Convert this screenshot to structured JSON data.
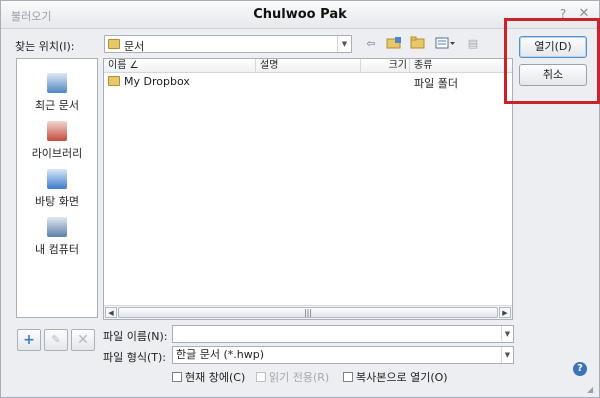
{
  "window": {
    "app_label": "불러오기",
    "title": "Chulwoo Pak",
    "help_glyph": "?",
    "close_glyph": "✕"
  },
  "location": {
    "label": "찾는 위치(I):",
    "value": "문서"
  },
  "toolbar": {
    "icons": [
      "back-icon",
      "folder-up-icon",
      "new-folder-icon",
      "view-menu-icon",
      "tools-icon"
    ]
  },
  "places": [
    {
      "label": "최근 문서",
      "icon": "recent-documents-icon",
      "color": "#4f86c6"
    },
    {
      "label": "라이브러리",
      "icon": "library-icon",
      "color": "#c44a3a"
    },
    {
      "label": "바탕 화면",
      "icon": "desktop-icon",
      "color": "#3e7cc9"
    },
    {
      "label": "내 컴퓨터",
      "icon": "computer-icon",
      "color": "#5a7fa8"
    }
  ],
  "file_list": {
    "columns": [
      "이름 ∠",
      "설명",
      "크기",
      "종류"
    ],
    "rows": [
      {
        "name": "My Dropbox",
        "type": "파일 폴더"
      }
    ]
  },
  "buttons": {
    "open": "열기(D)",
    "cancel": "취소"
  },
  "filename": {
    "label": "파일 이름(N):",
    "value": ""
  },
  "filetype": {
    "label": "파일 형식(T):",
    "value": "한글 문서 (*.hwp)"
  },
  "options": {
    "current_window": "현재 창에(C)",
    "read_only": "읽기 전용(R)",
    "open_copy": "복사본으로 열기(O)"
  },
  "colors": {
    "highlight": "#c8232a",
    "accent": "#3b72b8"
  }
}
